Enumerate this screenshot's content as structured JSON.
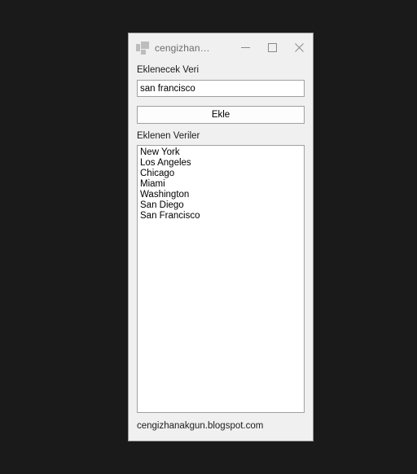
{
  "window": {
    "title": "cengizhan…",
    "icon": "app-grid-icon",
    "background_color": "#f0f0f0",
    "border_color": "#9b9b9b",
    "controls": {
      "minimize_label": "Minimize",
      "maximize_label": "Maximize",
      "close_label": "Close"
    }
  },
  "desktop": {
    "background_color": "#1a1a1a"
  },
  "form": {
    "input_label": "Eklenecek Veri",
    "input_value": "san francisco",
    "input_placeholder": "",
    "add_button_label": "Ekle",
    "list_label": "Eklenen Veriler",
    "list_items": [
      "New York",
      "Los Angeles",
      "Chicago",
      "Miami",
      "Washington",
      "San Diego",
      "San Francisco"
    ],
    "footer_text": "cengizhanakgun.blogspot.com"
  }
}
